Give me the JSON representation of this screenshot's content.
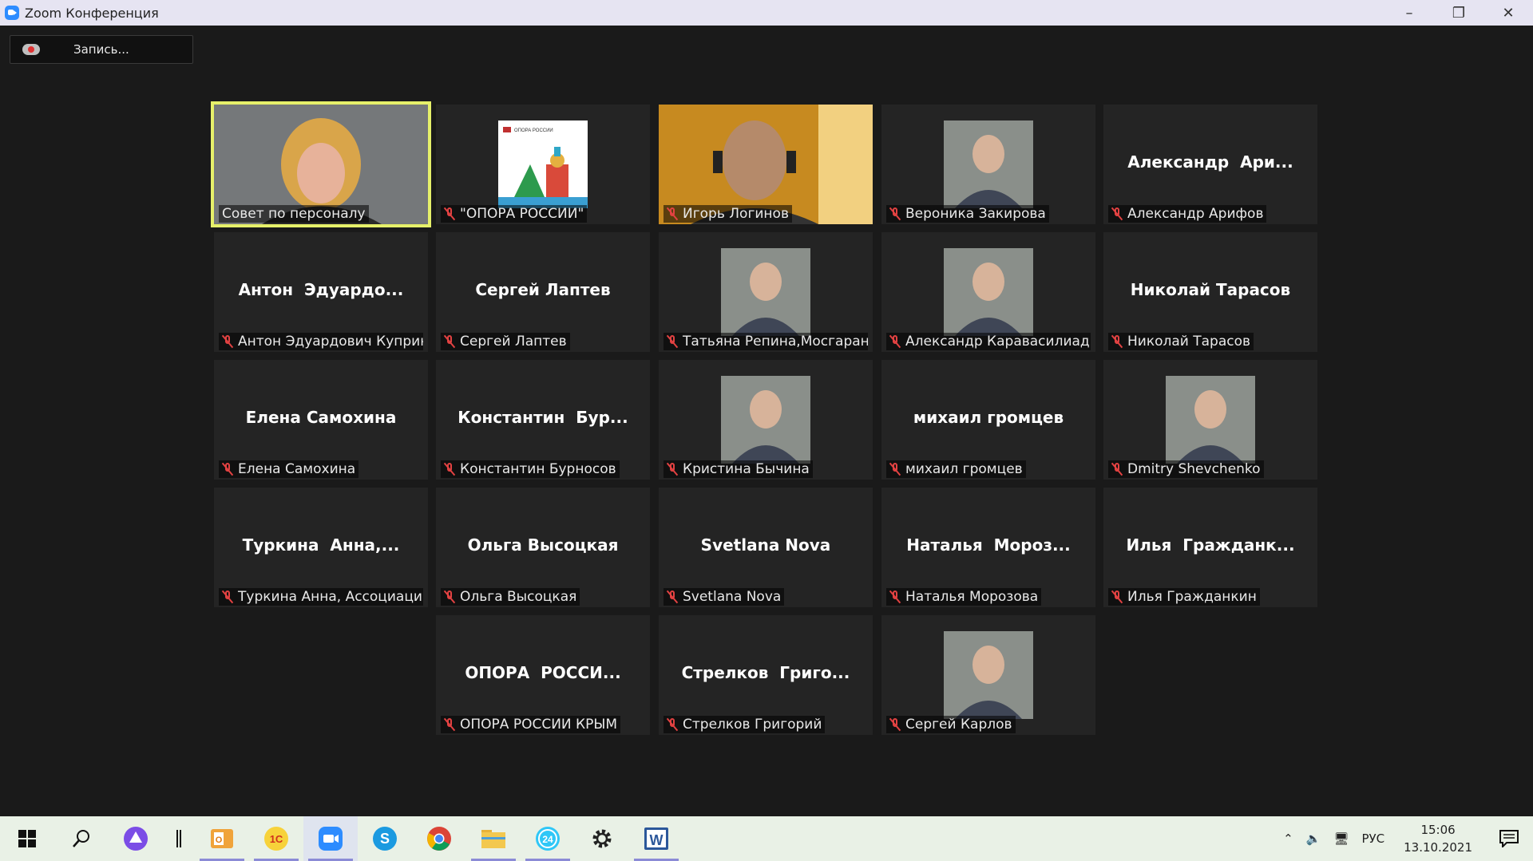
{
  "window": {
    "title": "Zoom Конференция"
  },
  "recording": {
    "label": "Запись..."
  },
  "participants": [
    {
      "big": "",
      "name": "Совет по персоналу",
      "muted": false,
      "media": "video-woman"
    },
    {
      "big": "",
      "name": "\"ОПОРА РОССИИ\"",
      "muted": true,
      "media": "logo"
    },
    {
      "big": "",
      "name": "Игорь Логинов",
      "muted": true,
      "media": "video-man"
    },
    {
      "big": "",
      "name": "Вероника Закирова",
      "muted": true,
      "media": "photo"
    },
    {
      "big": "Александр  Ари...",
      "name": "Александр Арифов",
      "muted": true,
      "media": ""
    },
    {
      "big": "Антон  Эдуардо...",
      "name": "Антон Эдуардович Куприн...",
      "muted": true,
      "media": ""
    },
    {
      "big": "Сергей Лаптев",
      "name": "Сергей Лаптев",
      "muted": true,
      "media": ""
    },
    {
      "big": "",
      "name": "Татьяна Репина,Мосгаран...",
      "muted": true,
      "media": "photo"
    },
    {
      "big": "",
      "name": "Александр Каравасилиади",
      "muted": true,
      "media": "photo"
    },
    {
      "big": "Николай Тарасов",
      "name": "Николай Тарасов",
      "muted": true,
      "media": ""
    },
    {
      "big": "Елена Самохина",
      "name": "Елена Самохина",
      "muted": true,
      "media": ""
    },
    {
      "big": "Константин  Бур...",
      "name": "Константин Бурносов",
      "muted": true,
      "media": ""
    },
    {
      "big": "",
      "name": "Кристина Бычина",
      "muted": true,
      "media": "photo"
    },
    {
      "big": "михаил громцев",
      "name": "михаил громцев",
      "muted": true,
      "media": ""
    },
    {
      "big": "",
      "name": "Dmitry Shevchenko",
      "muted": true,
      "media": "photo"
    },
    {
      "big": "Туркина  Анна,...",
      "name": "Туркина Анна, Ассоциация...",
      "muted": true,
      "media": ""
    },
    {
      "big": "Ольга Высоцкая",
      "name": "Ольга Высоцкая",
      "muted": true,
      "media": ""
    },
    {
      "big": "Svetlana Nova",
      "name": "Svetlana Nova",
      "muted": true,
      "media": ""
    },
    {
      "big": "Наталья  Мороз...",
      "name": "Наталья Морозова",
      "muted": true,
      "media": ""
    },
    {
      "big": "Илья  Гражданк...",
      "name": "Илья Гражданкин",
      "muted": true,
      "media": ""
    },
    {
      "big": "ОПОРА  РОССИ...",
      "name": "ОПОРА РОССИИ КРЫМ",
      "muted": true,
      "media": ""
    },
    {
      "big": "Стрелков  Григо...",
      "name": "Стрелков Григорий",
      "muted": true,
      "media": ""
    },
    {
      "big": "",
      "name": "Сергей Карлов",
      "muted": true,
      "media": "photo"
    }
  ],
  "logo_text": "ОПОРА РОССИИ",
  "taskbar": {
    "apps": [
      "windows-start-icon",
      "search-icon",
      "cortana-icon",
      "separator",
      "outlook-icon",
      "1c-icon",
      "zoom-icon",
      "skype-icon",
      "chrome-icon",
      "explorer-icon",
      "bitrix24-icon",
      "settings-icon",
      "word-icon"
    ],
    "lang": "РУС",
    "time": "15:06",
    "date": "13.10.2021"
  },
  "colors": {
    "active_border": "#e6f06a",
    "muted_red": "#e34242",
    "tile_bg": "#242424"
  }
}
